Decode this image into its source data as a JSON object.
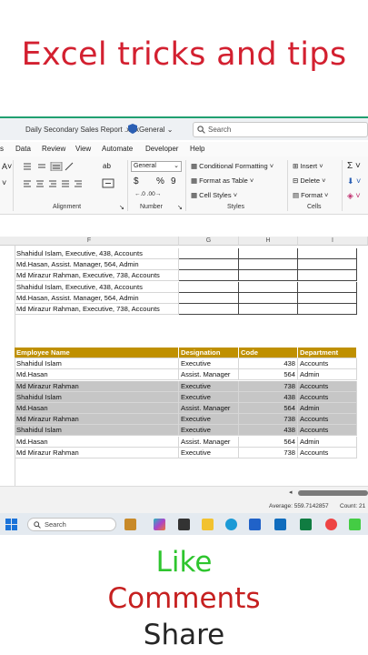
{
  "headline": "Excel tricks and tips",
  "window": {
    "doc_title": "Daily Secondary Sales Report .xlsx",
    "sensitivity": "General",
    "search_placeholder": "Search"
  },
  "menu": [
    "s",
    "Data",
    "Review",
    "View",
    "Automate",
    "Developer",
    "Help"
  ],
  "ribbon": {
    "number_format": "General",
    "alignment_label": "Alignment",
    "number_label": "Number",
    "styles_label": "Styles",
    "cells_label": "Cells",
    "conditional_formatting": "Conditional Formatting",
    "format_as_table": "Format as Table",
    "cell_styles": "Cell Styles",
    "insert": "Insert",
    "delete": "Delete",
    "format": "Format",
    "percent": "%",
    "currency": "$",
    "comma": "9",
    "autosum": "Σ"
  },
  "columns": [
    "F",
    "G",
    "H",
    "I"
  ],
  "combined_rows": [
    "Shahidul Islam, Executive, 438, Accounts",
    "Md.Hasan, Assist. Manager, 564, Admin",
    "Md Mirazur Rahman, Executive, 738, Accounts",
    "Shahidul Islam, Executive, 438, Accounts",
    "Md.Hasan, Assist. Manager, 564, Admin",
    "Md Mirazur Rahman, Executive, 738, Accounts"
  ],
  "table": {
    "headers": [
      "Employee Name",
      "Designation",
      "Code",
      "Department"
    ],
    "rows": [
      [
        "Shahidul Islam",
        "Executive",
        "438",
        "Accounts"
      ],
      [
        "Md.Hasan",
        "Assist. Manager",
        "564",
        "Admin"
      ],
      [
        "Md Mirazur Rahman",
        "Executive",
        "738",
        "Accounts"
      ],
      [
        "Shahidul Islam",
        "Executive",
        "438",
        "Accounts"
      ],
      [
        "Md.Hasan",
        "Assist. Manager",
        "564",
        "Admin"
      ],
      [
        "Md Mirazur Rahman",
        "Executive",
        "738",
        "Accounts"
      ],
      [
        "Shahidul Islam",
        "Executive",
        "438",
        "Accounts"
      ],
      [
        "Md.Hasan",
        "Assist. Manager",
        "564",
        "Admin"
      ],
      [
        "Md Mirazur Rahman",
        "Executive",
        "738",
        "Accounts"
      ]
    ],
    "selected_rows": 7
  },
  "status": {
    "average": "Average: 559.7142857",
    "count": "Count: 21"
  },
  "taskbar": {
    "search": "Search"
  },
  "cta": {
    "like": "Like",
    "comments": "Comments",
    "share": "Share"
  },
  "colors": {
    "headline": "#d32030",
    "header_fill": "#bf9000",
    "selection": "#c6c6c6",
    "like": "#2ec52e",
    "comments": "#c62020"
  }
}
